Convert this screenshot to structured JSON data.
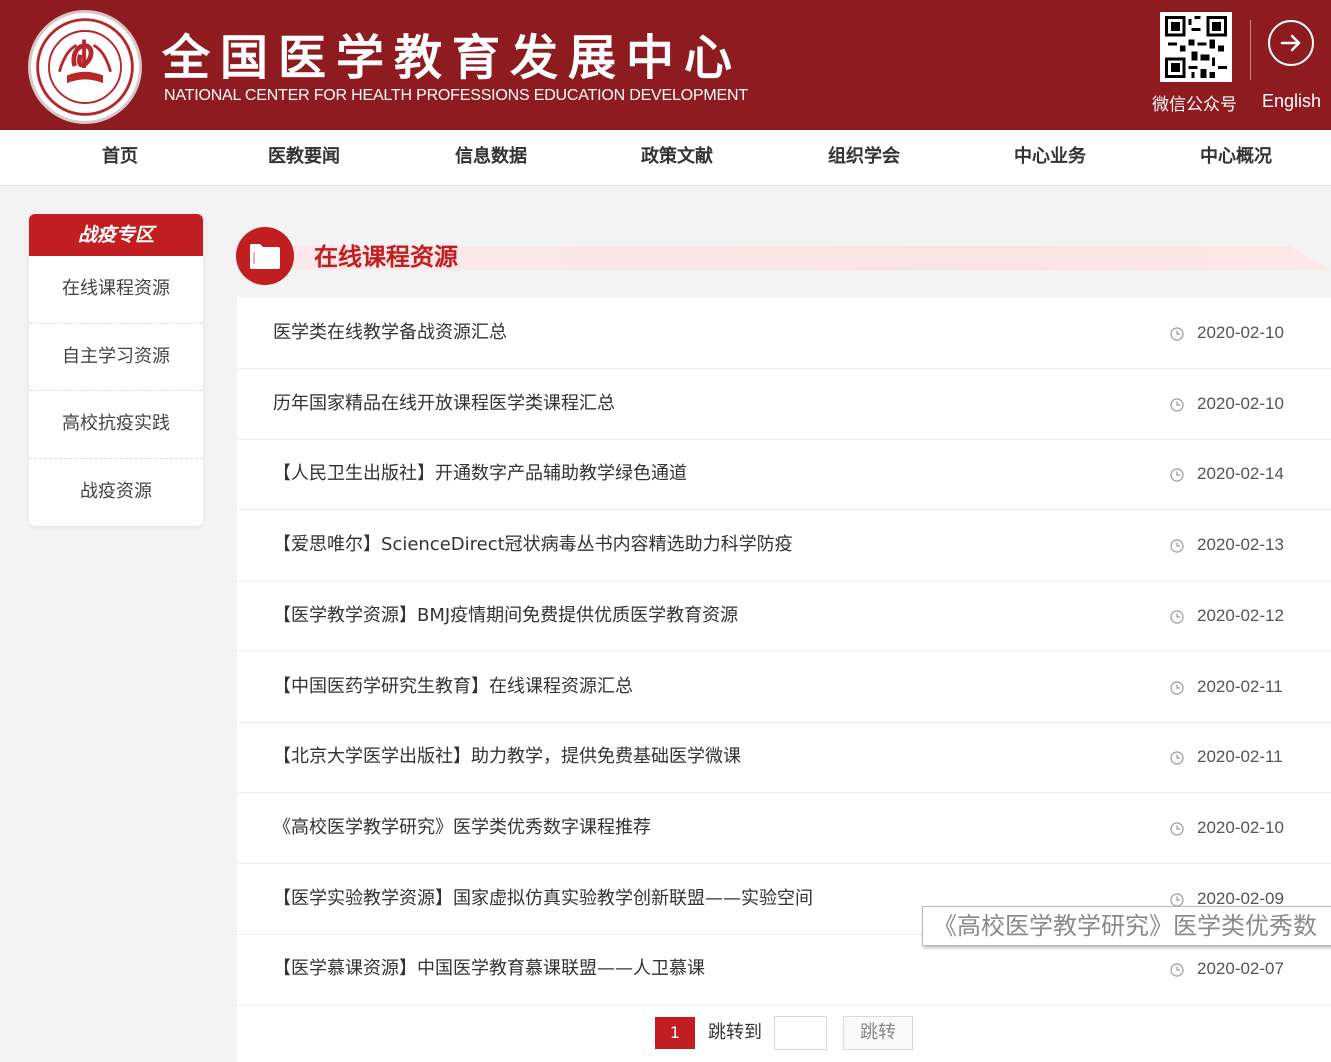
{
  "header": {
    "title": "全国医学教育发展中心",
    "subtitle": "NATIONAL CENTER FOR HEALTH PROFESSIONS EDUCATION DEVELOPMENT",
    "wechat_label": "微信公众号",
    "english_label": "English",
    "brand_color": "#8e1b1f"
  },
  "nav": {
    "items": [
      "首页",
      "医教要闻",
      "信息数据",
      "政策文献",
      "组织学会",
      "中心业务",
      "中心概况"
    ]
  },
  "sidebar": {
    "title": "战疫专区",
    "items": [
      "在线课程资源",
      "自主学习资源",
      "高校抗疫实践",
      "战疫资源"
    ]
  },
  "section": {
    "title": "在线课程资源",
    "icon": "folder-icon",
    "accent_color": "#c01e21"
  },
  "list": {
    "items": [
      {
        "title": "医学类在线教学备战资源汇总",
        "date": "2020-02-10"
      },
      {
        "title": "历年国家精品在线开放课程医学类课程汇总",
        "date": "2020-02-10"
      },
      {
        "title": "【人民卫生出版社】开通数字产品辅助教学绿色通道",
        "date": "2020-02-14"
      },
      {
        "title": "【爱思唯尔】ScienceDirect冠状病毒丛书内容精选助力科学防疫",
        "date": "2020-02-13"
      },
      {
        "title": "【医学教学资源】BMJ疫情期间免费提供优质医学教育资源",
        "date": "2020-02-12"
      },
      {
        "title": "【中国医药学研究生教育】在线课程资源汇总",
        "date": "2020-02-11"
      },
      {
        "title": "【北京大学医学出版社】助力教学，提供免费基础医学微课",
        "date": "2020-02-11"
      },
      {
        "title": "《高校医学教学研究》医学类优秀数字课程推荐",
        "date": "2020-02-10"
      },
      {
        "title": "【医学实验教学资源】国家虚拟仿真实验教学创新联盟——实验空间",
        "date": "2020-02-09"
      },
      {
        "title": "【医学慕课资源】中国医学教育慕课联盟——人卫慕课",
        "date": "2020-02-07"
      }
    ]
  },
  "tooltip": {
    "text": "《高校医学教学研究》医学类优秀数"
  },
  "pagination": {
    "current_page": "1",
    "jump_label": "跳转到",
    "jump_input_value": "",
    "jump_button": "跳转"
  }
}
